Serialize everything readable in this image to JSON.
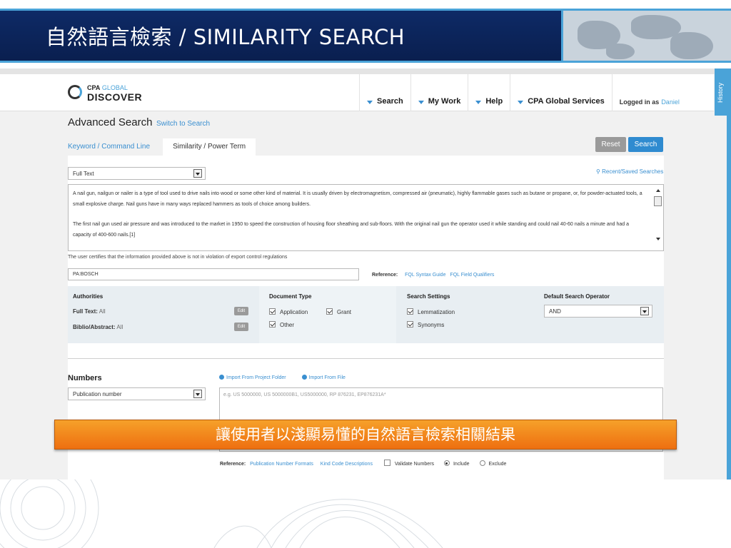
{
  "slide": {
    "title": "自然語言檢索 / SIMILARITY SEARCH",
    "callout": "讓使用者以淺顯易懂的自然語言檢索相關結果",
    "accent_color": "#4aa3d8",
    "banner_color": "#0e2a66",
    "callout_color": "#f08a1c"
  },
  "app": {
    "logo_line1_a": "CPA",
    "logo_line1_b": "GLOBAL",
    "logo_line2": "DISCOVER",
    "nav": [
      "Search",
      "My Work",
      "Help",
      "CPA Global Services"
    ],
    "logged_in_label": "Logged in as",
    "logged_in_user": "Daniel",
    "history_tab": "History"
  },
  "advanced": {
    "title": "Advanced Search",
    "switch_link": "Switch to Search",
    "tabs": [
      "Keyword / Command Line",
      "Similarity / Power Term"
    ],
    "active_tab": "Similarity / Power Term",
    "reset_label": "Reset",
    "search_label": "Search",
    "field_select": "Full Text",
    "recent_searches": "Recent/Saved Searches",
    "text_p1": "A nail gun, nailgun or nailer is a type of tool used to drive nails into wood or some other kind of material. It is usually driven by electromagnetism, compressed air (pneumatic), highly flammable gases such as butane or propane, or, for powder-actuated tools, a small explosive charge. Nail guns have in many ways replaced hammers as tools of choice among builders.",
    "text_p2": "The first nail gun used air pressure and was introduced to the market in 1950 to speed the construction of housing floor sheathing and sub-floors. With the original nail gun the operator used it while standing and could nail 40-60 nails a minute and had a capacity of 400-600 nails.[1]",
    "certify_text": "The user certifies that the information provided above is not in violation of export control regulations",
    "pa_value": "PA:BOSCH",
    "reference_label": "Reference:",
    "reference_links": [
      "FQL Syntax Guide",
      "FQL Field Qualifiers"
    ]
  },
  "settings": {
    "authorities": {
      "title": "Authorities",
      "fulltext_label": "Full Text:",
      "fulltext_value": "All",
      "biblio_label": "Biblio/Abstract:",
      "biblio_value": "All",
      "edit_label": "Edit"
    },
    "doc_type": {
      "title": "Document Type",
      "application": "Application",
      "grant": "Grant",
      "other": "Other"
    },
    "search_settings": {
      "title": "Search Settings",
      "lemmatization": "Lemmatization",
      "synonyms": "Synonyms"
    },
    "operator": {
      "title": "Default Search Operator",
      "value": "AND"
    }
  },
  "numbers": {
    "title": "Numbers",
    "select": "Publication number",
    "import_project": "Import From Project Folder",
    "import_file": "Import From File",
    "placeholder": "e.g. US 5000000, US 5000000B1, US5000000, RP 876231, EP876231A*",
    "reference_label": "Reference:",
    "reference_links": [
      "Publication Number Formats",
      "Kind Code Descriptions"
    ],
    "validate": "Validate Numbers",
    "include": "Include",
    "exclude": "Exclude"
  }
}
